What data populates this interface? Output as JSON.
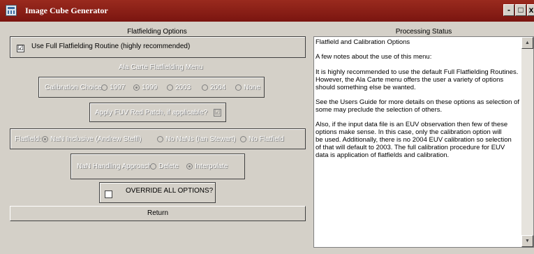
{
  "window": {
    "title": "Image Cube Generator",
    "buttons": {
      "minimize": "-",
      "maximize": "□",
      "close": "x"
    }
  },
  "left": {
    "header": "Flatfielding Options",
    "full_flat": {
      "label": "Use Full Flatfielding Routine (highly recommended)",
      "checked": "☑"
    },
    "menu_title": "Ala Carte Flatfielding Menu",
    "calibration": {
      "label": "Calibration Choice:",
      "options": [
        "1997",
        "1999",
        "2003",
        "2004",
        "None"
      ],
      "selected": "1999"
    },
    "fuv_patch": {
      "label": "Apply FUV Red Patch, if applicable?",
      "checked": "☑"
    },
    "flatfield": {
      "label": "Flatfield:",
      "options": [
        "NaN Inclusive (Andrew Steffl)",
        "No NaNs (Ian Stewart)",
        "No Flatfield"
      ],
      "selected": "NaN Inclusive (Andrew Steffl)"
    },
    "nan_handling": {
      "label": "NaN Handling Approach:",
      "options": [
        "Delete",
        "Interpolate"
      ],
      "selected": "Interpolate"
    },
    "override": {
      "label": "OVERRIDE ALL OPTIONS?",
      "checked": ""
    },
    "return_label": "Return"
  },
  "right": {
    "header": "Processing Status",
    "lines": [
      "Flatfield and Calibration Options",
      "",
      "A few notes about the use of this menu:",
      "",
      "It is highly recommended to use the default Full Flatfielding Routines.",
      "However, the Ala Carte menu offers the user a variety of options",
      "should something else be wanted.",
      "",
      "See the Users Guide for more details on these options as selection of",
      "some may preclude the selection of others.",
      "",
      "Also, if the input data file is an EUV observation then few of these",
      "options make sense. In this case, only the calibration option will",
      "be used. Additionally, there is no 2004 EUV calibration so selection",
      "of that will default to 2003. The full calibration procedure for EUV",
      "data is application of flatfields and calibration."
    ],
    "scroll_up": "▲",
    "scroll_down": "▼"
  }
}
